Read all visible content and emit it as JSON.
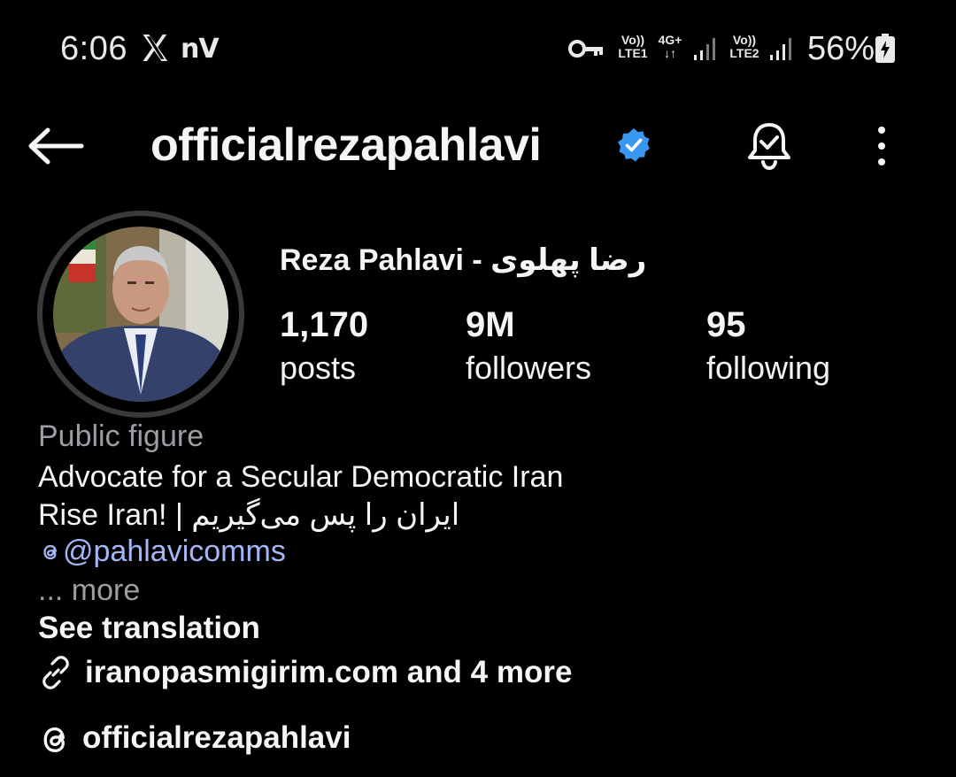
{
  "status_bar": {
    "time": "6:06",
    "carrier_badge": "nV",
    "sim1_top": "Vo))",
    "sim1_bottom": "LTE1",
    "network_top": "4G+",
    "network_bottom": "↓↑",
    "sim2_top": "Vo))",
    "sim2_bottom": "LTE2",
    "battery_percent": "56%"
  },
  "header": {
    "username": "officialrezapahlavi"
  },
  "profile": {
    "display_name": "Reza Pahlavi - رضا پهلوی",
    "stats": [
      {
        "value": "1,170",
        "label": "posts"
      },
      {
        "value": "9M",
        "label": "followers"
      },
      {
        "value": "95",
        "label": "following"
      }
    ]
  },
  "bio": {
    "category": "Public figure",
    "line1": "Advocate for a Secular Democratic Iran",
    "line2": "Rise Iran! | ایران را پس می‌گیریم",
    "threads_mention": "@pahlavicomms",
    "more": "... more",
    "see_translation": "See translation",
    "link": "iranopasmigirim.com and 4 more",
    "threads_handle": "officialrezapahlavi"
  },
  "colors": {
    "background": "#000000",
    "text": "#f5f5f5",
    "muted": "#9b9ea3",
    "mention": "#a6b5f5",
    "verified": "#3897f0"
  }
}
